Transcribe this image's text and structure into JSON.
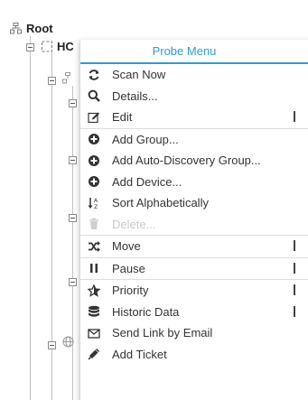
{
  "tree": {
    "root_label": "Root",
    "probe_label": "HC"
  },
  "menu": {
    "title": "Probe Menu",
    "items": [
      {
        "label": "Scan Now",
        "icon": "refresh-icon"
      },
      {
        "label": "Details...",
        "icon": "search-icon"
      },
      {
        "label": "Edit",
        "icon": "edit-icon",
        "submenu": true
      },
      {
        "label": "Add Group...",
        "icon": "plus-circle-icon"
      },
      {
        "label": "Add Auto-Discovery Group...",
        "icon": "plus-circle-icon"
      },
      {
        "label": "Add Device...",
        "icon": "plus-circle-icon"
      },
      {
        "label": "Sort Alphabetically",
        "icon": "sort-az-icon"
      },
      {
        "label": "Delete...",
        "icon": "trash-icon",
        "disabled": true
      },
      {
        "label": "Move",
        "icon": "shuffle-icon",
        "submenu": true
      },
      {
        "label": "Pause",
        "icon": "pause-icon",
        "submenu": true
      },
      {
        "label": "Priority",
        "icon": "star-icon",
        "submenu": true
      },
      {
        "label": "Historic Data",
        "icon": "database-icon",
        "submenu": true
      },
      {
        "label": "Send Link by Email",
        "icon": "envelope-icon"
      },
      {
        "label": "Add Ticket",
        "icon": "ticket-icon"
      }
    ]
  },
  "colors": {
    "accent": "#2f9bd1",
    "text": "#333333",
    "disabled": "#c9c9c9"
  }
}
